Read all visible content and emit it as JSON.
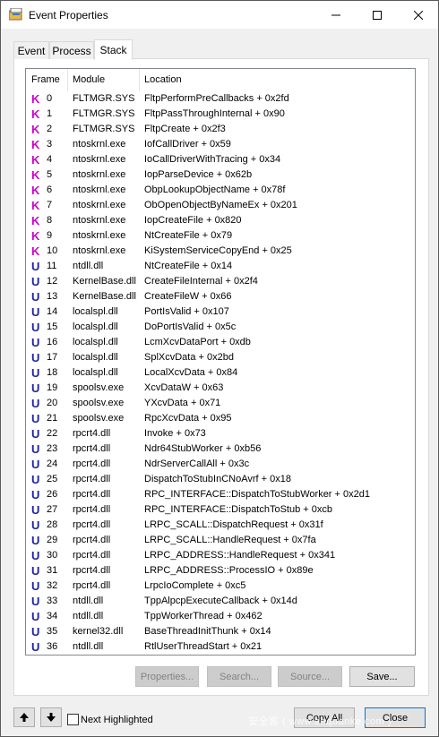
{
  "window": {
    "title": "Event Properties"
  },
  "tabs": [
    {
      "label": "Event"
    },
    {
      "label": "Process"
    },
    {
      "label": "Stack"
    }
  ],
  "columns": {
    "frame": "Frame",
    "module": "Module",
    "location": "Location"
  },
  "rows": [
    {
      "kind": "K",
      "frame": "0",
      "module": "FLTMGR.SYS",
      "location": "FltpPerformPreCallbacks + 0x2fd"
    },
    {
      "kind": "K",
      "frame": "1",
      "module": "FLTMGR.SYS",
      "location": "FltpPassThroughInternal + 0x90"
    },
    {
      "kind": "K",
      "frame": "2",
      "module": "FLTMGR.SYS",
      "location": "FltpCreate + 0x2f3"
    },
    {
      "kind": "K",
      "frame": "3",
      "module": "ntoskrnl.exe",
      "location": "IofCallDriver + 0x59"
    },
    {
      "kind": "K",
      "frame": "4",
      "module": "ntoskrnl.exe",
      "location": "IoCallDriverWithTracing + 0x34"
    },
    {
      "kind": "K",
      "frame": "5",
      "module": "ntoskrnl.exe",
      "location": "IopParseDevice + 0x62b"
    },
    {
      "kind": "K",
      "frame": "6",
      "module": "ntoskrnl.exe",
      "location": "ObpLookupObjectName + 0x78f"
    },
    {
      "kind": "K",
      "frame": "7",
      "module": "ntoskrnl.exe",
      "location": "ObOpenObjectByNameEx + 0x201"
    },
    {
      "kind": "K",
      "frame": "8",
      "module": "ntoskrnl.exe",
      "location": "IopCreateFile + 0x820"
    },
    {
      "kind": "K",
      "frame": "9",
      "module": "ntoskrnl.exe",
      "location": "NtCreateFile + 0x79"
    },
    {
      "kind": "K",
      "frame": "10",
      "module": "ntoskrnl.exe",
      "location": "KiSystemServiceCopyEnd + 0x25"
    },
    {
      "kind": "U",
      "frame": "11",
      "module": "ntdll.dll",
      "location": "NtCreateFile + 0x14"
    },
    {
      "kind": "U",
      "frame": "12",
      "module": "KernelBase.dll",
      "location": "CreateFileInternal + 0x2f4"
    },
    {
      "kind": "U",
      "frame": "13",
      "module": "KernelBase.dll",
      "location": "CreateFileW + 0x66"
    },
    {
      "kind": "U",
      "frame": "14",
      "module": "localspl.dll",
      "location": "PortIsValid + 0x107"
    },
    {
      "kind": "U",
      "frame": "15",
      "module": "localspl.dll",
      "location": "DoPortIsValid + 0x5c"
    },
    {
      "kind": "U",
      "frame": "16",
      "module": "localspl.dll",
      "location": "LcmXcvDataPort + 0xdb"
    },
    {
      "kind": "U",
      "frame": "17",
      "module": "localspl.dll",
      "location": "SplXcvData + 0x2bd"
    },
    {
      "kind": "U",
      "frame": "18",
      "module": "localspl.dll",
      "location": "LocalXcvData + 0x84"
    },
    {
      "kind": "U",
      "frame": "19",
      "module": "spoolsv.exe",
      "location": "XcvDataW + 0x63"
    },
    {
      "kind": "U",
      "frame": "20",
      "module": "spoolsv.exe",
      "location": "YXcvData + 0x71"
    },
    {
      "kind": "U",
      "frame": "21",
      "module": "spoolsv.exe",
      "location": "RpcXcvData + 0x95"
    },
    {
      "kind": "U",
      "frame": "22",
      "module": "rpcrt4.dll",
      "location": "Invoke + 0x73"
    },
    {
      "kind": "U",
      "frame": "23",
      "module": "rpcrt4.dll",
      "location": "Ndr64StubWorker + 0xb56"
    },
    {
      "kind": "U",
      "frame": "24",
      "module": "rpcrt4.dll",
      "location": "NdrServerCallAll + 0x3c"
    },
    {
      "kind": "U",
      "frame": "25",
      "module": "rpcrt4.dll",
      "location": "DispatchToStubInCNoAvrf + 0x18"
    },
    {
      "kind": "U",
      "frame": "26",
      "module": "rpcrt4.dll",
      "location": "RPC_INTERFACE::DispatchToStubWorker + 0x2d1"
    },
    {
      "kind": "U",
      "frame": "27",
      "module": "rpcrt4.dll",
      "location": "RPC_INTERFACE::DispatchToStub + 0xcb"
    },
    {
      "kind": "U",
      "frame": "28",
      "module": "rpcrt4.dll",
      "location": "LRPC_SCALL::DispatchRequest + 0x31f"
    },
    {
      "kind": "U",
      "frame": "29",
      "module": "rpcrt4.dll",
      "location": "LRPC_SCALL::HandleRequest + 0x7fa"
    },
    {
      "kind": "U",
      "frame": "30",
      "module": "rpcrt4.dll",
      "location": "LRPC_ADDRESS::HandleRequest + 0x341"
    },
    {
      "kind": "U",
      "frame": "31",
      "module": "rpcrt4.dll",
      "location": "LRPC_ADDRESS::ProcessIO + 0x89e"
    },
    {
      "kind": "U",
      "frame": "32",
      "module": "rpcrt4.dll",
      "location": "LrpcIoComplete + 0xc5"
    },
    {
      "kind": "U",
      "frame": "33",
      "module": "ntdll.dll",
      "location": "TppAlpcpExecuteCallback + 0x14d"
    },
    {
      "kind": "U",
      "frame": "34",
      "module": "ntdll.dll",
      "location": "TppWorkerThread + 0x462"
    },
    {
      "kind": "U",
      "frame": "35",
      "module": "kernel32.dll",
      "location": "BaseThreadInitThunk + 0x14"
    },
    {
      "kind": "U",
      "frame": "36",
      "module": "ntdll.dll",
      "location": "RtlUserThreadStart + 0x21"
    }
  ],
  "stack_buttons": {
    "properties": "Properties...",
    "search": "Search...",
    "source": "Source...",
    "save": "Save..."
  },
  "footer": {
    "next_highlighted": "Next Highlighted",
    "copy_all": "Copy All",
    "close": "Close",
    "watermark": "安全客 ( www.anquanke.com )"
  },
  "colors": {
    "kernel_badge": "#cc00cc",
    "user_badge": "#1f1fa6",
    "accent": "#0078d7"
  },
  "icons": [
    "app-icon",
    "minimize-icon",
    "maximize-icon",
    "close-icon",
    "arrow-up-icon",
    "arrow-down-icon"
  ]
}
